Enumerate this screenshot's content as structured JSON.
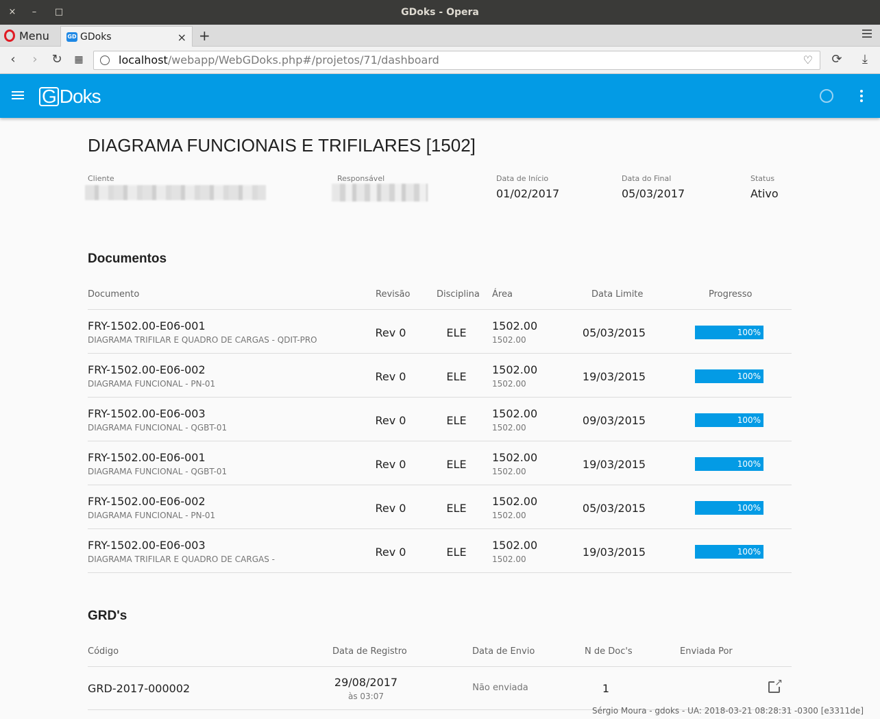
{
  "window": {
    "title": "GDoks - Opera",
    "close": "×",
    "minimize": "–",
    "maximize": "□"
  },
  "tabbar": {
    "menu_label": "Menu",
    "tab_title": "GDoks",
    "tab_fav": "GD",
    "tab_close": "×",
    "new_tab": "+"
  },
  "addressbar": {
    "url_host": "localhost",
    "url_path": "/webapp/WebGDoks.php#/projetos/71/dashboard"
  },
  "app": {
    "logo_g": "G",
    "logo_rest": "Doks"
  },
  "project": {
    "title": "DIAGRAMA FUNCIONAIS E TRIFILARES [1502]",
    "cliente_label": "Cliente",
    "responsavel_label": "Responsável",
    "inicio_label": "Data de Início",
    "inicio": "01/02/2017",
    "final_label": "Data do Final",
    "final": "05/03/2017",
    "status_label": "Status",
    "status": "Ativo"
  },
  "documentos": {
    "title": "Documentos",
    "headers": [
      "Documento",
      "Revisão",
      "Disciplina",
      "Área",
      "Data Limite",
      "Progresso"
    ],
    "rows": [
      {
        "code": "FRY-1502.00-E06-001",
        "desc": "DIAGRAMA TRIFILAR E QUADRO DE CARGAS - QDIT-PRO",
        "rev": "Rev 0",
        "disc": "ELE",
        "area": "1502.00",
        "area_sub": "1502.00",
        "date": "05/03/2015",
        "progress": 100,
        "progress_label": "100%"
      },
      {
        "code": "FRY-1502.00-E06-002",
        "desc": "DIAGRAMA FUNCIONAL - PN-01",
        "rev": "Rev 0",
        "disc": "ELE",
        "area": "1502.00",
        "area_sub": "1502.00",
        "date": "19/03/2015",
        "progress": 100,
        "progress_label": "100%"
      },
      {
        "code": "FRY-1502.00-E06-003",
        "desc": "DIAGRAMA FUNCIONAL - QGBT-01",
        "rev": "Rev 0",
        "disc": "ELE",
        "area": "1502.00",
        "area_sub": "1502.00",
        "date": "09/03/2015",
        "progress": 100,
        "progress_label": "100%"
      },
      {
        "code": "FRY-1502.00-E06-001",
        "desc": "DIAGRAMA FUNCIONAL - QGBT-01",
        "rev": "Rev 0",
        "disc": "ELE",
        "area": "1502.00",
        "area_sub": "1502.00",
        "date": "19/03/2015",
        "progress": 100,
        "progress_label": "100%"
      },
      {
        "code": "FRY-1502.00-E06-002",
        "desc": "DIAGRAMA FUNCIONAL - PN-01",
        "rev": "Rev 0",
        "disc": "ELE",
        "area": "1502.00",
        "area_sub": "1502.00",
        "date": "05/03/2015",
        "progress": 100,
        "progress_label": "100%"
      },
      {
        "code": "FRY-1502.00-E06-003",
        "desc": "DIAGRAMA TRIFILAR E QUADRO DE CARGAS -",
        "rev": "Rev 0",
        "disc": "ELE",
        "area": "1502.00",
        "area_sub": "1502.00",
        "date": "19/03/2015",
        "progress": 100,
        "progress_label": "100%"
      }
    ]
  },
  "grds": {
    "title": "GRD's",
    "headers": [
      "Código",
      "Data de Registro",
      "Data de Envio",
      "N de Doc's",
      "Enviada Por"
    ],
    "rows": [
      {
        "code": "GRD-2017-000002",
        "reg_date": "29/08/2017",
        "reg_time": "às 03:07",
        "envio": "Não enviada",
        "ndocs": "1",
        "enviada_por": ""
      }
    ]
  },
  "footer": "Sérgio Moura - gdoks - UA: 2018-03-21 08:28:31 -0300 [e3311de]",
  "colors": {
    "accent": "#039be5",
    "titlebar": "#3a3a38"
  }
}
